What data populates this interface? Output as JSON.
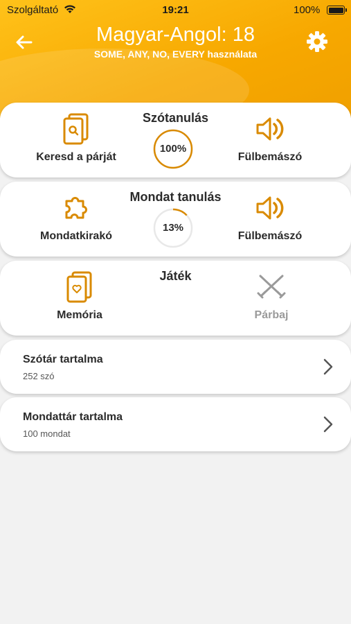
{
  "status_bar": {
    "carrier": "Szolgáltató",
    "time": "19:21",
    "battery": "100%"
  },
  "header": {
    "title": "Magyar-Angol: 18",
    "subtitle": "SOME, ANY, NO, EVERY használata"
  },
  "sections": {
    "vocab": {
      "title": "Szótanulás",
      "left_label": "Keresd a párját",
      "right_label": "Fülbemászó",
      "progress_label": "100%",
      "progress": 1.0
    },
    "sentence": {
      "title": "Mondat tanulás",
      "left_label": "Mondatkirakó",
      "right_label": "Fülbemászó",
      "progress_label": "13%",
      "progress": 0.13
    },
    "game": {
      "title": "Játék",
      "left_label": "Memória",
      "right_label": "Párbaj"
    }
  },
  "list": [
    {
      "title": "Szótár tartalma",
      "subtitle": "252 szó"
    },
    {
      "title": "Mondattár tartalma",
      "subtitle": "100 mondat"
    }
  ],
  "colors": {
    "accent": "#f5a300",
    "icon": "#d98a00",
    "disabled": "#9a9a9a"
  }
}
